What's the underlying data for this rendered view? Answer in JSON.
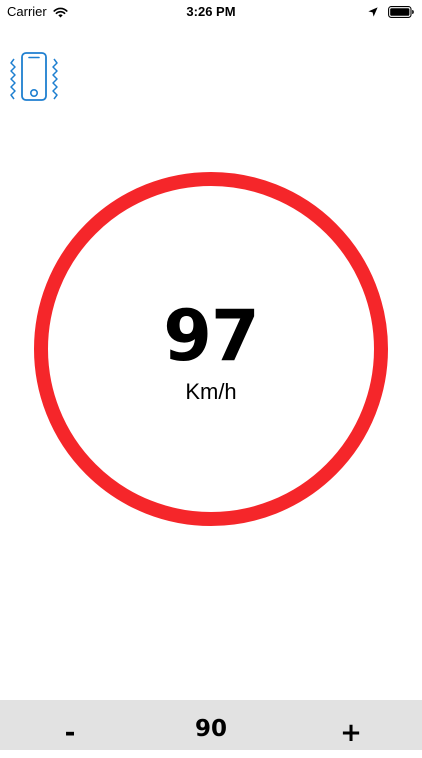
{
  "status_bar": {
    "carrier": "Carrier",
    "time": "3:26 PM",
    "icons": [
      "wifi-icon",
      "location-arrow-icon",
      "battery-icon"
    ]
  },
  "vibrate_toggle": {
    "icon": "phone-vibrate-icon",
    "color": "#1e7fd0"
  },
  "speedometer": {
    "speed": "97",
    "unit": "Km/h",
    "ring_color": "#f5262a"
  },
  "speed_limit": {
    "decrease_label": "-",
    "value": "90",
    "increase_label": "+",
    "bar_color": "#e2e2e2"
  }
}
